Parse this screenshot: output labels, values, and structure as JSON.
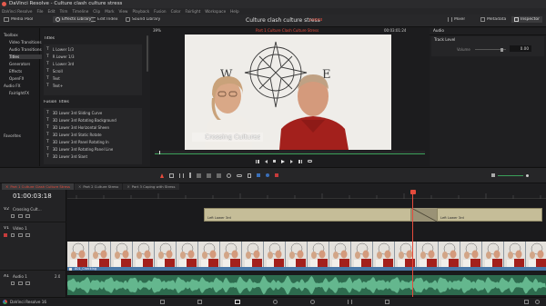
{
  "titlebar": {
    "app": "DaVinci Resolve - Culture clash culture stress"
  },
  "menubar": {
    "items": [
      "DaVinci Resolve",
      "File",
      "Edit",
      "Trim",
      "Timeline",
      "Clip",
      "Mark",
      "View",
      "Playback",
      "Fusion",
      "Color",
      "Fairlight",
      "Workspace",
      "Help"
    ]
  },
  "toolbar": {
    "media_pool": "Media Pool",
    "effects_library": "Effects Library",
    "edit_index": "Edit Index",
    "sound_library": "Sound Library",
    "project_title": "Culture clash culture stress",
    "edited_status": "Edited",
    "mixer": "Mixer",
    "metadata": "Metadata",
    "inspector": "Inspector"
  },
  "effects_panel": {
    "tree": [
      "Toolbox",
      "Video Transitions",
      "Audio Transitions",
      "Titles",
      "Generators",
      "Effects",
      "OpenFX",
      "Audio FX",
      "FairlightFX"
    ],
    "titles_header": "Titles",
    "titles": [
      "L Lower 1/3",
      "R Lower 1/3",
      "L Lower 3rd",
      "Scroll",
      "Text",
      "Text+"
    ],
    "fusion_header": "Fusion Titles",
    "fusion_titles": [
      "3D Lower 3rd Sliding Curve",
      "3D Lower 3rd Rotating Background",
      "3D Lower 3rd Horizontal Sheen",
      "3D Lower 3rd Static Rotate",
      "3D Lower 3rd Panel Rotating In",
      "3D Lower 3rd Rotating Panel Line",
      "3D Lower 3rd Slant"
    ],
    "favorites": "Favorites"
  },
  "viewer": {
    "zoom": "39%",
    "timeline_name": "Part 1 Culture Clash Culture Stress",
    "timecode": "00:03:01:24",
    "lower_third_text": "Crossing Cultures"
  },
  "inspector": {
    "tab": "Audio",
    "section": "Track Level",
    "volume_label": "Volume",
    "volume_value": "0.00"
  },
  "timeline": {
    "tabs": [
      "Part 1 Culture Clash Culture Stress",
      "Part 2 Culture Stress",
      "Part 3 Coping with Stress"
    ],
    "timecode": "01:00:03:18",
    "tracks": [
      {
        "id": "V2",
        "name": "Crossing Cult..."
      },
      {
        "id": "V1",
        "name": "Video 1"
      },
      {
        "id": "A1",
        "name": "Audio 1",
        "level": "2.0"
      }
    ],
    "title_clip_1": "Left Lower 3rd",
    "title_clip_2": "Left Lower 3rd",
    "audio_clip": "A01_Checking"
  },
  "footer": {
    "app": "DaVinci Resolve 16"
  },
  "colors": {
    "accent": "#e64b3c",
    "title_clip": "#c5bd98",
    "video_clip": "#4a78a8",
    "audio_clip": "#2d6b4e"
  }
}
